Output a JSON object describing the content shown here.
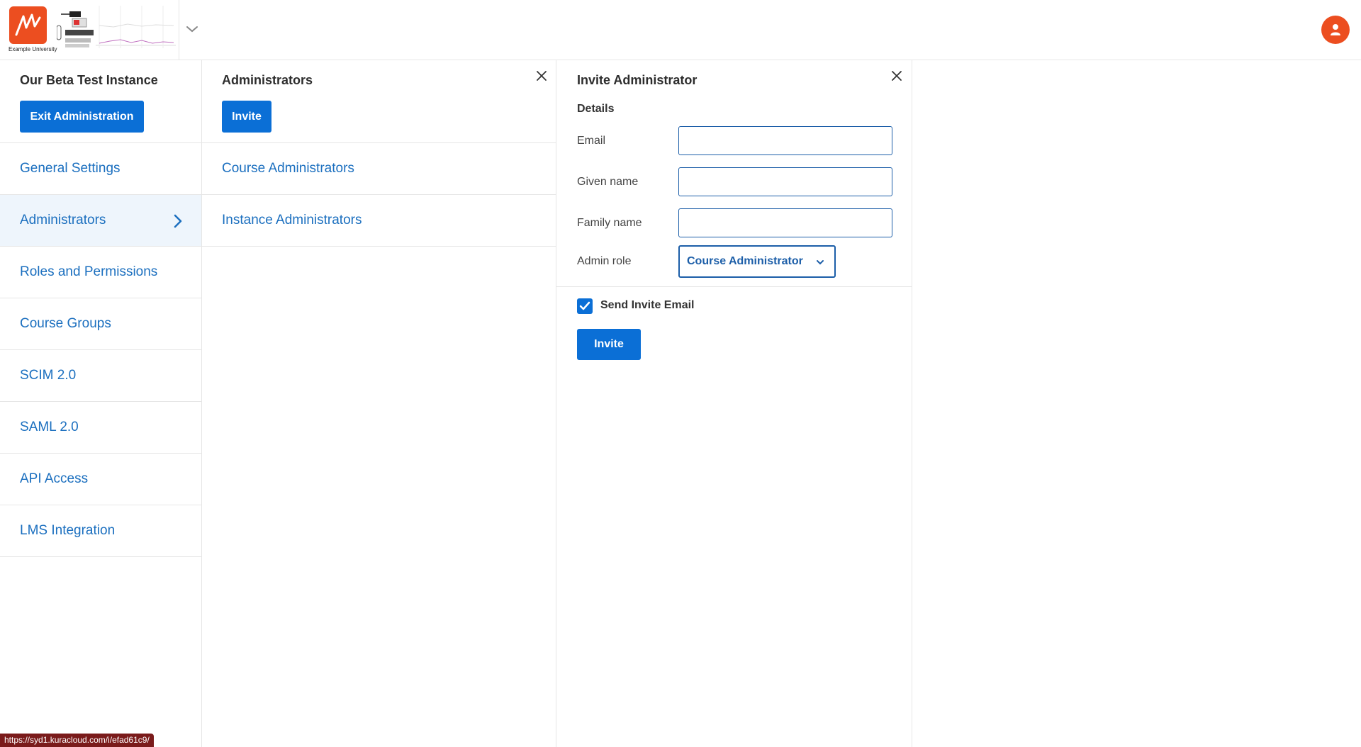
{
  "header": {
    "logo_caption": "Example University",
    "logo_icon": "institution-logo",
    "menu_icon": "chevron-down-icon",
    "user_icon": "user-icon",
    "accent_color": "#ec4e20"
  },
  "nav": {
    "instance_title": "Our Beta Test Instance",
    "exit_label": "Exit Administration",
    "items": [
      {
        "label": "General Settings"
      },
      {
        "label": "Administrators",
        "active": true
      },
      {
        "label": "Roles and Permissions"
      },
      {
        "label": "Course Groups"
      },
      {
        "label": "SCIM 2.0"
      },
      {
        "label": "SAML 2.0"
      },
      {
        "label": "API Access"
      },
      {
        "label": "LMS Integration"
      }
    ]
  },
  "admins": {
    "title": "Administrators",
    "invite_label": "Invite",
    "items": [
      {
        "label": "Course Administrators"
      },
      {
        "label": "Instance Administrators"
      }
    ]
  },
  "invite": {
    "title": "Invite Administrator",
    "section": "Details",
    "email_label": "Email",
    "email_value": "",
    "given_label": "Given name",
    "given_value": "",
    "family_label": "Family name",
    "family_value": "",
    "role_label": "Admin role",
    "role_value": "Course Administrator",
    "send_email_label": "Send Invite Email",
    "send_email_checked": true,
    "submit_label": "Invite"
  },
  "status_bar": {
    "url": "https://syd1.kuracloud.com/i/efad61c9/"
  },
  "colors": {
    "primary": "#0b6fd6",
    "link": "#1b6fbf",
    "active_bg": "#eef5fc"
  }
}
